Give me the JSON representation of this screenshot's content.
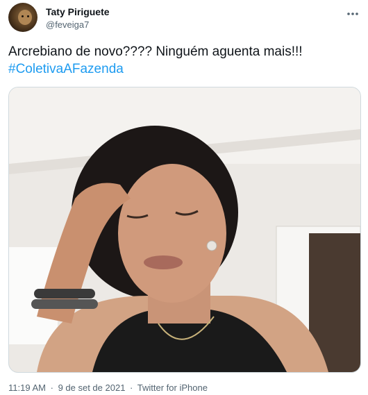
{
  "author": {
    "name": "Taty Piriguete",
    "handle": "@feveiga7"
  },
  "tweet": {
    "text": "Arcrebiano de novo???? Ninguém aguenta mais!!!",
    "hashtag": "#ColetivaAFazenda"
  },
  "footer": {
    "time": "11:19 AM",
    "separator": "·",
    "date": "9 de set de 2021",
    "source": "Twitter for iPhone"
  },
  "icons": {
    "more": "more-options-icon"
  },
  "colors": {
    "link": "#1d9bf0",
    "secondary_text": "#536471",
    "primary_text": "#0f1419",
    "border": "#cfd9de"
  }
}
